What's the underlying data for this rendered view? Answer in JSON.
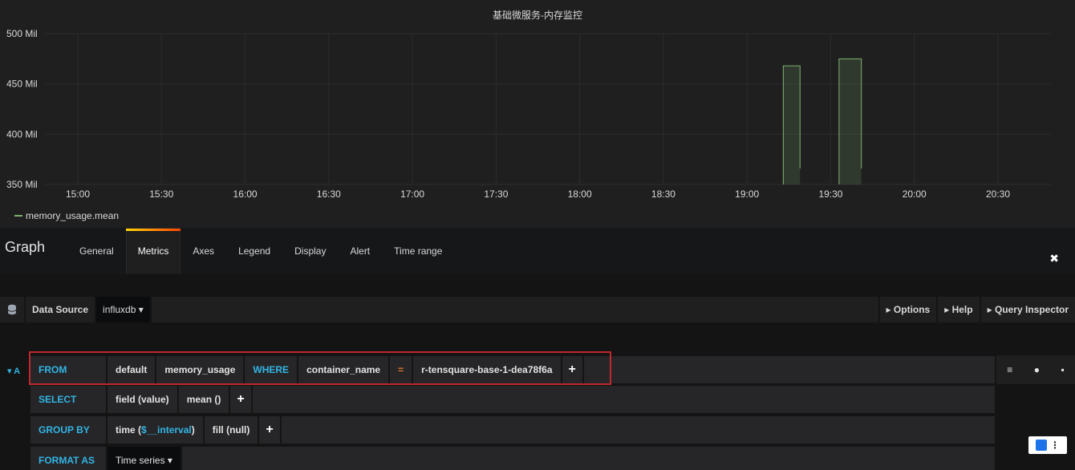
{
  "panel": {
    "title": "基础微服务-内存监控",
    "legend_label": "memory_usage.mean"
  },
  "chart_data": {
    "type": "line",
    "title": "基础微服务-内存监控",
    "xlabel": "",
    "ylabel": "",
    "x_ticks": [
      "15:00",
      "15:30",
      "16:00",
      "16:30",
      "17:00",
      "17:30",
      "18:00",
      "18:30",
      "19:00",
      "19:30",
      "20:00",
      "20:30"
    ],
    "y_ticks": [
      "350 Mil",
      "400 Mil",
      "450 Mil",
      "500 Mil"
    ],
    "ylim": [
      350,
      500
    ],
    "y_unit": "Mil",
    "grid": true,
    "legend_position": "bottom-left",
    "series": [
      {
        "name": "memory_usage.mean",
        "color": "#7eb26d",
        "segments": [
          {
            "start": "19:13",
            "end": "19:19",
            "value": 468
          },
          {
            "start": "19:33",
            "end": "19:41",
            "value": 475
          }
        ]
      }
    ]
  },
  "editor": {
    "title": "Graph",
    "tabs": [
      "General",
      "Metrics",
      "Axes",
      "Legend",
      "Display",
      "Alert",
      "Time range"
    ],
    "active_tab": "Metrics",
    "close_glyph": "✖"
  },
  "datasource": {
    "label": "Data Source",
    "value": "influxdb ▾",
    "options_label": "▸ Options",
    "help_label": "▸ Help",
    "inspector_label": "▸ Query Inspector"
  },
  "query": {
    "ref": "▾ A",
    "from_kw": "FROM",
    "policy": "default",
    "measurement": "memory_usage",
    "where_kw": "WHERE",
    "tag_key": "container_name",
    "operator": "=",
    "tag_value": "r-tensquare-base-1-dea78f6a",
    "select_kw": "SELECT",
    "field": "field (value)",
    "agg": "mean ()",
    "group_kw": "GROUP BY",
    "group_time_prefix": "time (",
    "group_time_var": "$__interval",
    "group_time_suffix": ")",
    "group_fill": "fill (null)",
    "format_kw": "FORMAT AS",
    "format_value": "Time series ▾",
    "plus": "+",
    "menu_glyph": "≡",
    "eye_glyph": "●",
    "trash_glyph": "▪"
  },
  "corner": {
    "dots": "⋮"
  }
}
